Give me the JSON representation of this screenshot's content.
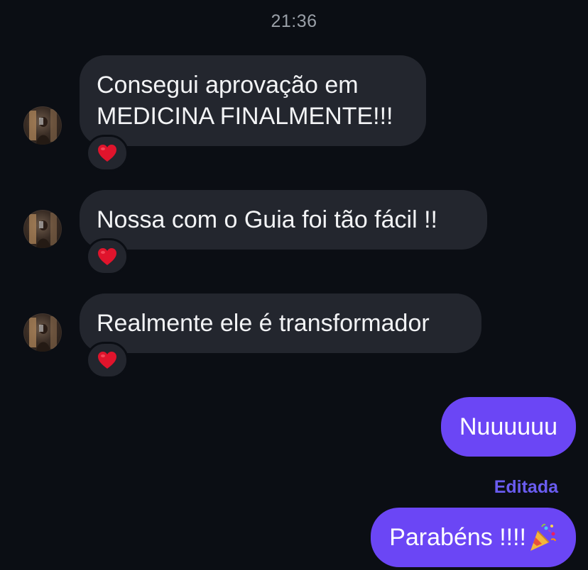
{
  "chat": {
    "timestamp": "21:36",
    "incoming": [
      {
        "text": "Consegui aprovação em\nMEDICINA FINALMENTE!!!",
        "reaction": "heart"
      },
      {
        "text": "Nossa com o Guia foi tão fácil !!",
        "reaction": "heart"
      },
      {
        "text": "Realmente ele é transformador",
        "reaction": "heart"
      }
    ],
    "outgoing": [
      {
        "text": "Nuuuuuu"
      },
      {
        "text": "Parabéns !!!!",
        "edited_label": "Editada",
        "emoji": "party-popper"
      }
    ],
    "colors": {
      "background": "#0b0e14",
      "incoming_bubble": "#23262e",
      "outgoing_bubble": "#6b46f5",
      "edited_label": "#6a5cf0",
      "heart": "#e0142c"
    }
  }
}
